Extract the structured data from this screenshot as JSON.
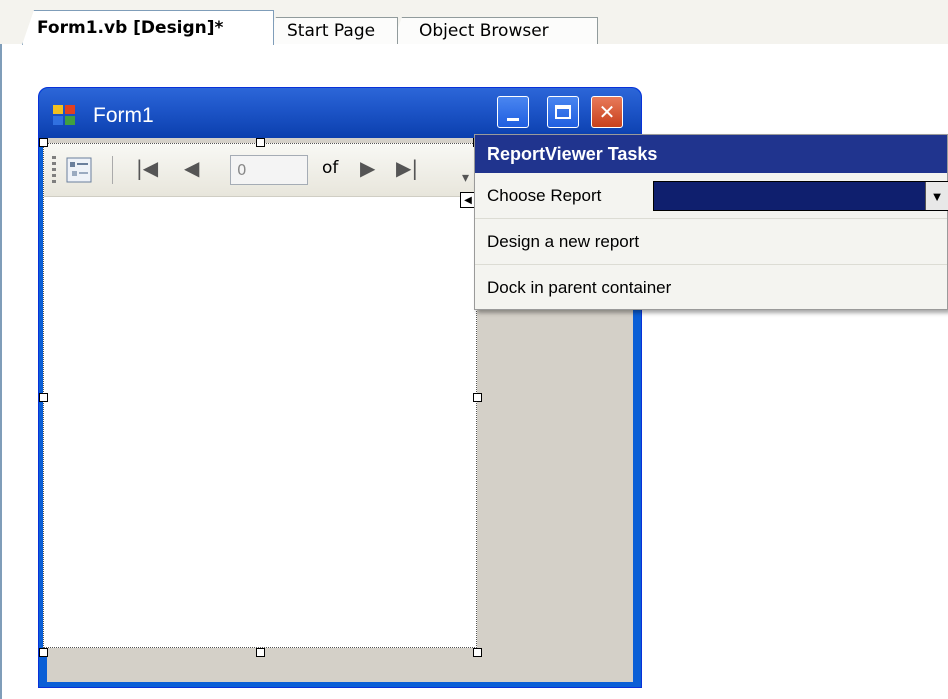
{
  "tabs": [
    {
      "label": "Form1.vb [Design]*",
      "active": true
    },
    {
      "label": "Start Page",
      "active": false
    },
    {
      "label": "Object Browser",
      "active": false
    }
  ],
  "form": {
    "title": "Form1"
  },
  "report_viewer": {
    "page_value": "0",
    "of_label": "of"
  },
  "tasks_panel": {
    "header": "ReportViewer Tasks",
    "choose_report_label": "Choose Report",
    "choose_report_value": "",
    "design_new_report": "Design a new report",
    "dock_in_parent": "Dock in parent container"
  },
  "colors": {
    "title_blue": "#0a5fd6",
    "tasks_header": "#20348e",
    "combo_selected": "#0f1f6e"
  }
}
